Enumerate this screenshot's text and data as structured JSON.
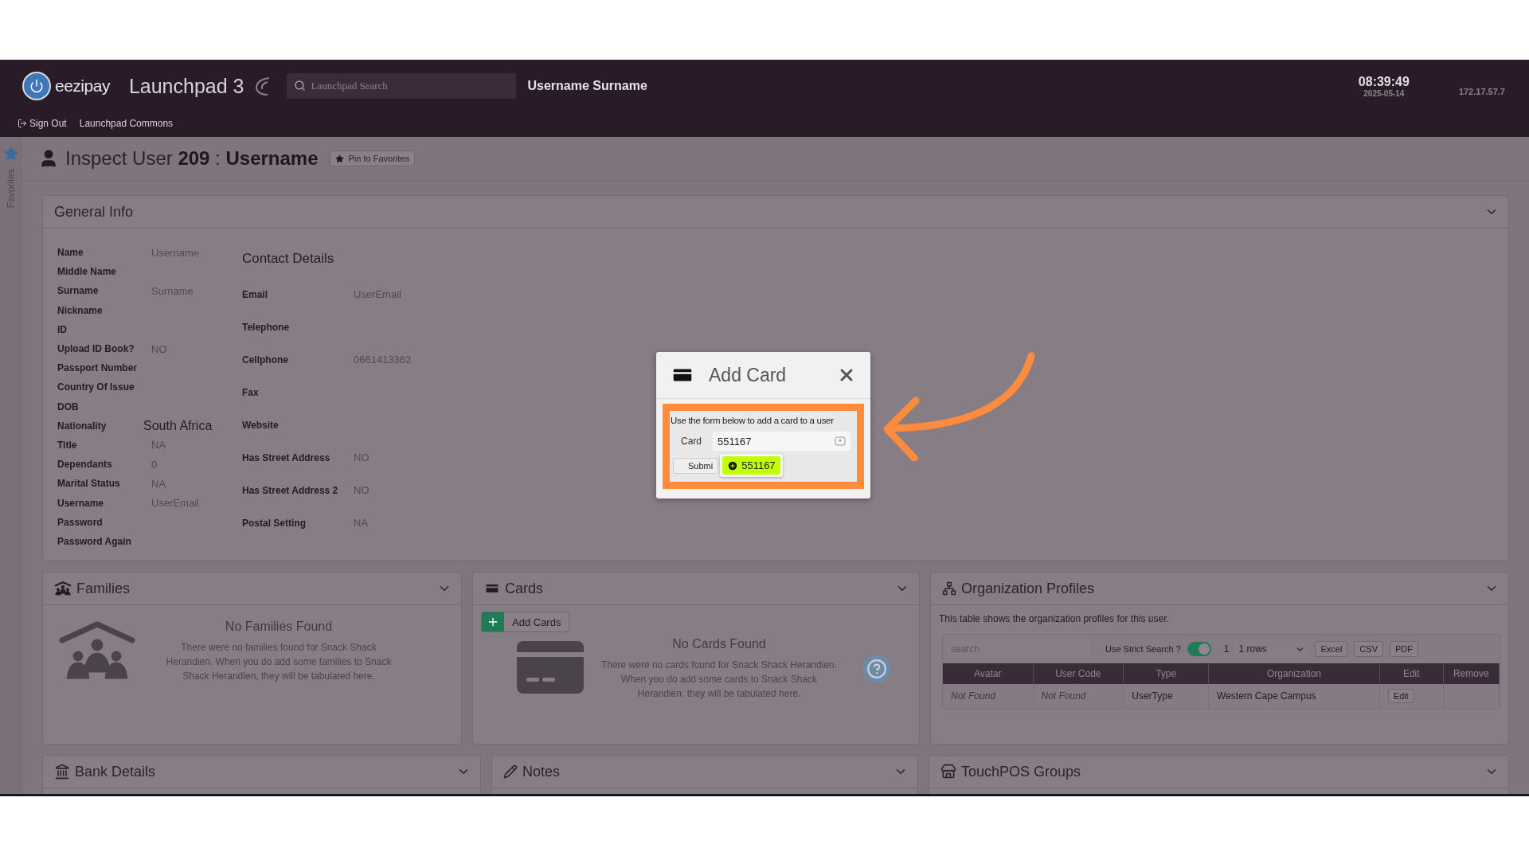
{
  "header": {
    "logo_text": "eezipay",
    "app_title": "Launchpad 3",
    "search": {
      "placeholder": "Launchpad Search"
    },
    "user_name": "Username Surname",
    "time": "08:39:49",
    "date": "2025-05-14",
    "ip": "172.17.57.7",
    "links": [
      {
        "label": "Sign Out",
        "kind": "signout"
      },
      {
        "label": "Launchpad Commons",
        "kind": "plain"
      }
    ]
  },
  "sidebar": {
    "label": "Favorites"
  },
  "page_title": {
    "prefix": "Inspect User",
    "id": "209",
    "separator": ":",
    "name": "Username",
    "pin_button": "Pin to Favorites"
  },
  "general_info": {
    "title": "General Info",
    "fields": [
      {
        "label": "Name",
        "value": "Username"
      },
      {
        "label": "Middle Name"
      },
      {
        "label": "Surname",
        "value": "Surname"
      },
      {
        "label": "Nickname"
      },
      {
        "label": "ID"
      },
      {
        "label": "Upload ID Book?",
        "value": "NO"
      },
      {
        "label": "Passport Number"
      },
      {
        "label": "Country Of Issue"
      },
      {
        "label": "DOB"
      },
      {
        "label": "Nationality",
        "value": "South Africa",
        "emphasis": true
      },
      {
        "label": "Title",
        "value": "NA"
      },
      {
        "label": "Dependants",
        "value": "0"
      },
      {
        "label": "Marital Status",
        "value": "NA"
      },
      {
        "label": "Username",
        "value": "UserEmail"
      },
      {
        "label": "Password"
      },
      {
        "label": "Password Again"
      }
    ],
    "contact_title": "Contact Details",
    "contact_fields": [
      {
        "label": "Email",
        "value": "UserEmail"
      },
      {
        "label": "Telephone"
      },
      {
        "label": "Cellphone",
        "value": "0661413362"
      },
      {
        "label": "Fax"
      },
      {
        "label": "Website"
      },
      {
        "label": "Has Street Address",
        "value": "NO"
      },
      {
        "label": "Has Street Address 2",
        "value": "NO"
      },
      {
        "label": "Postal Setting",
        "value": "NA"
      }
    ]
  },
  "families": {
    "title": "Families",
    "empty_title": "No Families Found",
    "empty_text": "There were no families found for Snack Shack Herandien. When you do add some families to Snack Shack Herandien, they will be tabulated here."
  },
  "cards": {
    "title": "Cards",
    "add_button": "Add Cards",
    "empty_title": "No Cards Found",
    "empty_text": "There were no cards found for Snack Shack Herandien. When you do add some cards to Snack Shack Herandien, they will be tabulated here."
  },
  "organization_profiles": {
    "title": "Organization Profiles",
    "description": "This table shows the organization profiles for this user.",
    "table": {
      "search": {
        "placeholder": "search"
      },
      "strict_search": {
        "label": "Use Strict Search ?",
        "on": true
      },
      "count": "1",
      "rows_select": "1 rows",
      "export_buttons": [
        "Excel",
        "CSV",
        "PDF"
      ],
      "columns": [
        "Avatar",
        "User Code",
        "Type",
        "Organization",
        "Edit",
        "Remove"
      ],
      "rows": [
        {
          "cells": [
            {
              "kind": "missing",
              "text": "Not Found"
            },
            {
              "kind": "missing",
              "text": "Not Found"
            },
            {
              "kind": "text",
              "text": "UserType"
            },
            {
              "kind": "text",
              "text": "Western Cape Campus"
            },
            {
              "kind": "button",
              "text": "Edit"
            },
            {
              "kind": "empty"
            }
          ]
        }
      ]
    }
  },
  "bank_details": {
    "title": "Bank Details"
  },
  "notes": {
    "title": "Notes"
  },
  "touchpos_groups": {
    "title": "TouchPOS Groups"
  },
  "modal": {
    "title": "Add Card",
    "instruction": "Use the form below to add a card to a user",
    "card_label": "Card",
    "card_value": "551167",
    "submit_button": "Submi",
    "suggestion": "551167"
  }
}
